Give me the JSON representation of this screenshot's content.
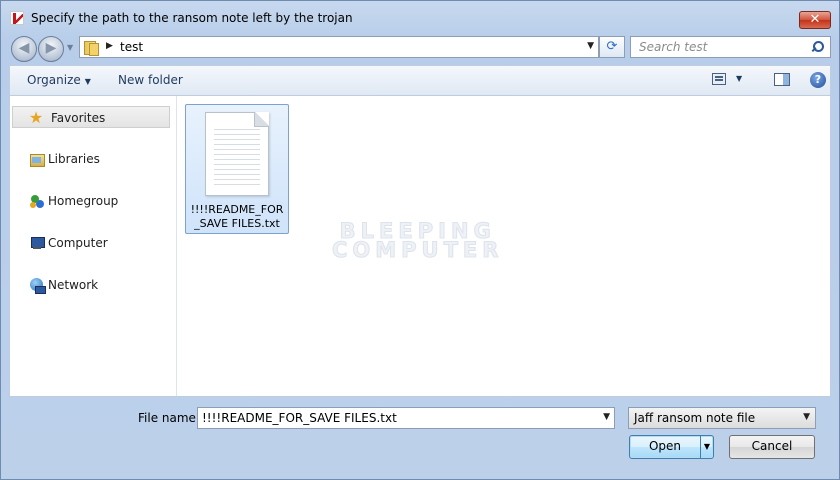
{
  "window": {
    "title": "Specify the path to the ransom note left by the trojan",
    "close_glyph": "✕"
  },
  "navigation": {
    "back_glyph": "◀",
    "forward_glyph": "▶",
    "breadcrumb": "test",
    "refresh_glyph": "⟳",
    "search_placeholder": "Search test"
  },
  "toolbar": {
    "organize_label": "Organize",
    "new_folder_label": "New folder",
    "help_glyph": "?"
  },
  "sidebar": {
    "items": [
      {
        "label": "Favorites",
        "icon": "star-icon"
      },
      {
        "label": "Libraries",
        "icon": "libraries-icon"
      },
      {
        "label": "Homegroup",
        "icon": "homegroup-icon"
      },
      {
        "label": "Computer",
        "icon": "computer-icon"
      },
      {
        "label": "Network",
        "icon": "network-icon"
      }
    ]
  },
  "files": [
    {
      "name": "!!!!README_FOR_SAVE FILES.txt",
      "icon": "text-file-icon",
      "selected": true
    }
  ],
  "watermark": {
    "line1": "BLEEPING",
    "line2": "COMPUTER"
  },
  "footer": {
    "file_name_label": "File name:",
    "file_name_value": "!!!!README_FOR_SAVE FILES.txt",
    "file_type_value": "Jaff ransom note file",
    "open_label": "Open",
    "cancel_label": "Cancel"
  },
  "colors": {
    "window_frame": "#c7d9ef",
    "selection": "#cfe3fa",
    "close_button": "#c2331a"
  }
}
